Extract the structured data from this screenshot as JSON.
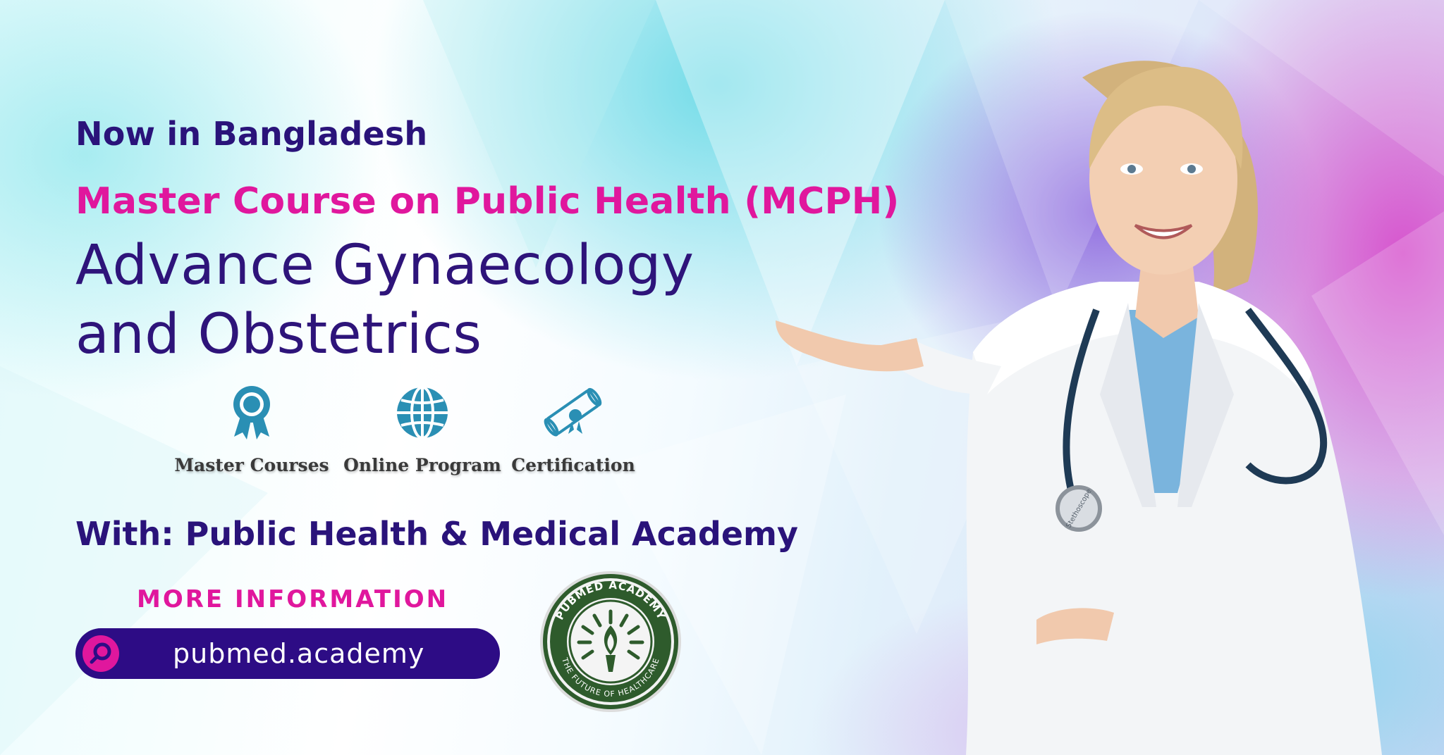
{
  "banner": {
    "eyebrow": "Now in Bangladesh",
    "course_title": "Master Course on Public Health (MCPH)",
    "program_title_line1": "Advance Gynaecology",
    "program_title_line2": "and Obstetrics",
    "features": [
      {
        "label": "Master Courses",
        "icon": "award-ribbon-icon"
      },
      {
        "label": "Online Program",
        "icon": "globe-icon"
      },
      {
        "label": "Certification",
        "icon": "diploma-scroll-icon"
      }
    ],
    "with_line": "With: Public Health & Medical Academy",
    "more_info_label": "MORE INFORMATION",
    "website": "pubmed.academy",
    "seal": {
      "top_text": "PUBMED ACADEMY",
      "bottom_text": "THE FUTURE OF HEALTHCARE"
    },
    "stethoscope_text": "Stethoscope"
  },
  "colors": {
    "navy": "#2a137a",
    "magenta": "#e0179d",
    "pill": "#2d0c85",
    "icon_teal": "#2a8fb4",
    "seal_green": "#2e5b2c"
  }
}
